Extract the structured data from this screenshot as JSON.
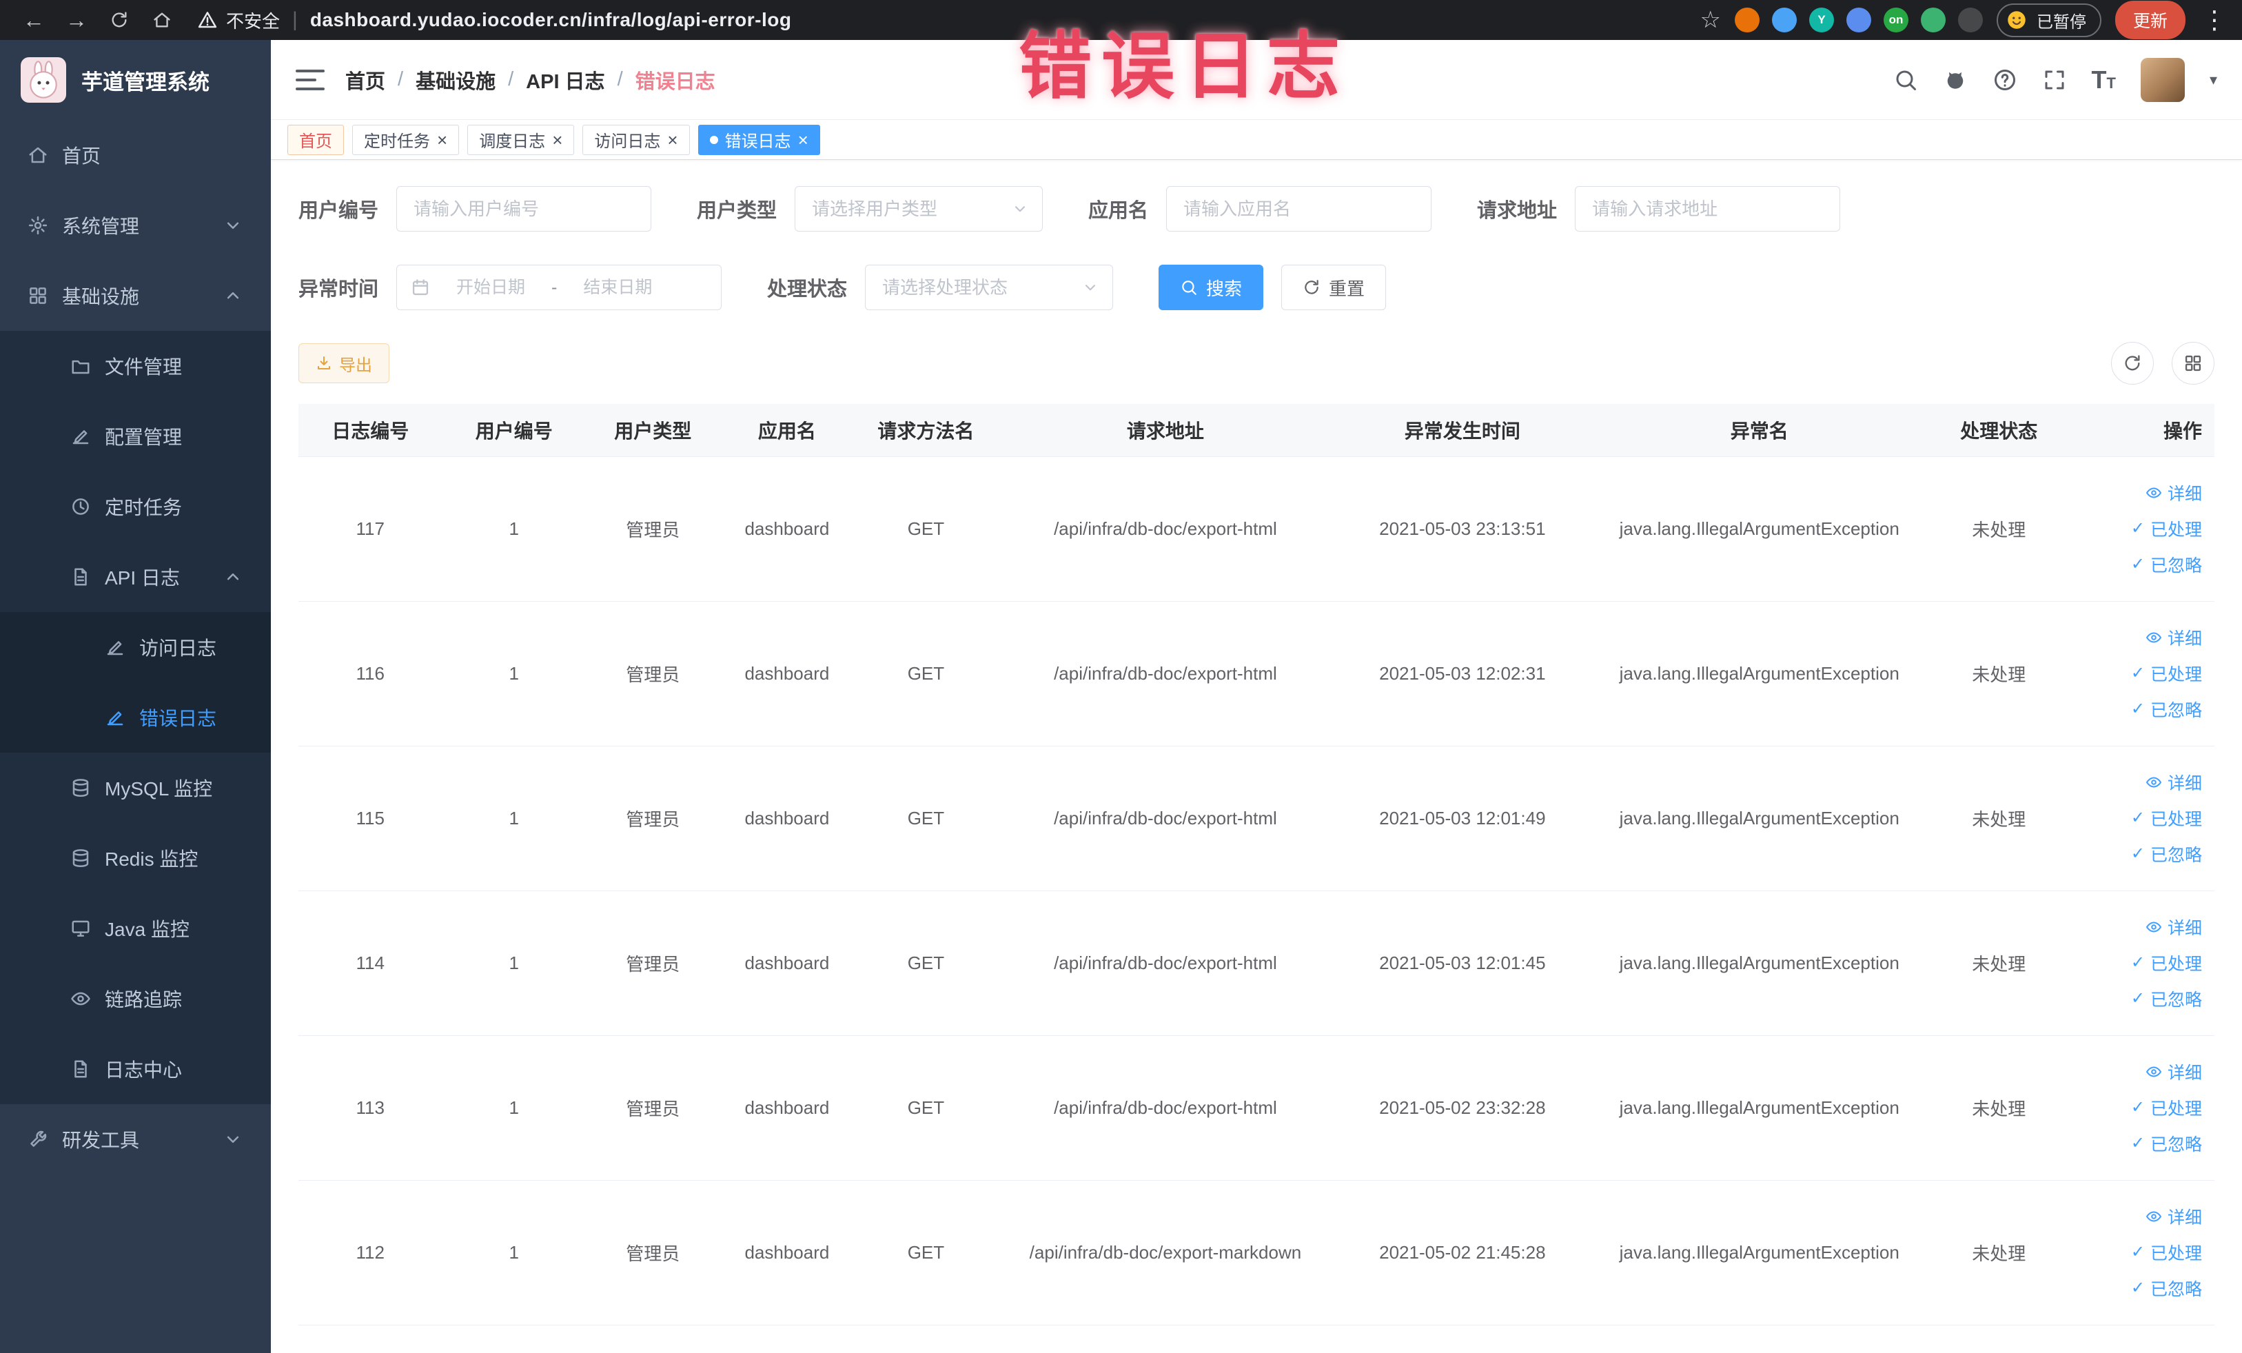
{
  "browser": {
    "security_label": "不安全",
    "url": "dashboard.yudao.iocoder.cn/infra/log/api-error-log",
    "paused_label": "已暂停",
    "update_label": "更新",
    "extensions": [
      {
        "color": "#e8710a"
      },
      {
        "color": "#4aa3f5"
      },
      {
        "color": "#12b7a5",
        "label": "Y"
      },
      {
        "color": "#5b8def"
      },
      {
        "color": "#27a844",
        "label": "on"
      },
      {
        "color": "#3cb371"
      },
      {
        "color": "#47484a"
      }
    ]
  },
  "overlay": {
    "title": "错误日志"
  },
  "sidebar": {
    "logo_title": "芋道管理系统",
    "menu": [
      {
        "label": "首页",
        "icon": "ic-home",
        "l1": true
      },
      {
        "label": "系统管理",
        "icon": "ic-gear",
        "l1": true,
        "chevron": true
      },
      {
        "label": "基础设施",
        "icon": "ic-grid",
        "l1": true,
        "chevron": true,
        "up": true
      },
      {
        "label": "文件管理",
        "icon": "ic-folder",
        "l2": true
      },
      {
        "label": "配置管理",
        "icon": "ic-edit",
        "l2": true
      },
      {
        "label": "定时任务",
        "icon": "ic-clock",
        "l2": true
      },
      {
        "label": "API 日志",
        "icon": "ic-doc",
        "l2": true,
        "chevron": true,
        "up": true
      },
      {
        "label": "访问日志",
        "icon": "ic-edit",
        "l3": true
      },
      {
        "label": "错误日志",
        "icon": "ic-edit",
        "l3": true,
        "active": true
      },
      {
        "label": "MySQL 监控",
        "icon": "ic-db",
        "l2": true
      },
      {
        "label": "Redis 监控",
        "icon": "ic-db",
        "l2": true
      },
      {
        "label": "Java 监控",
        "icon": "ic-monitor",
        "l2": true
      },
      {
        "label": "链路追踪",
        "icon": "ic-eye",
        "l2": true
      },
      {
        "label": "日志中心",
        "icon": "ic-doc",
        "l2": true
      },
      {
        "label": "研发工具",
        "icon": "ic-wrench",
        "l1": true,
        "chevron": true
      }
    ]
  },
  "header": {
    "breadcrumb": [
      {
        "label": "首页"
      },
      {
        "label": "基础设施"
      },
      {
        "label": "API 日志"
      },
      {
        "label": "错误日志",
        "current": true
      }
    ]
  },
  "tabs": [
    {
      "label": "首页",
      "affix": true
    },
    {
      "label": "定时任务",
      "closable": true
    },
    {
      "label": "调度日志",
      "closable": true
    },
    {
      "label": "访问日志",
      "closable": true
    },
    {
      "label": "错误日志",
      "closable": true,
      "active": true
    }
  ],
  "filters": {
    "user_id": {
      "label": "用户编号",
      "placeholder": "请输入用户编号"
    },
    "user_type": {
      "label": "用户类型",
      "placeholder": "请选择用户类型"
    },
    "app_name": {
      "label": "应用名",
      "placeholder": "请输入应用名"
    },
    "request_url": {
      "label": "请求地址",
      "placeholder": "请输入请求地址"
    },
    "exception_time": {
      "label": "异常时间",
      "start_placeholder": "开始日期",
      "separator": "-",
      "end_placeholder": "结束日期"
    },
    "process_status": {
      "label": "处理状态",
      "placeholder": "请选择处理状态"
    },
    "search_label": "搜索",
    "reset_label": "重置"
  },
  "toolbar": {
    "export_label": "导出"
  },
  "table": {
    "columns": [
      "日志编号",
      "用户编号",
      "用户类型",
      "应用名",
      "请求方法名",
      "请求地址",
      "异常发生时间",
      "异常名",
      "处理状态",
      "操作"
    ],
    "action_labels": [
      "详细",
      "已处理",
      "已忽略"
    ],
    "rows": [
      {
        "id": "117",
        "user_id": "1",
        "user_type": "管理员",
        "app": "dashboard",
        "method": "GET",
        "url": "/api/infra/db-doc/export-html",
        "time": "2021-05-03 23:13:51",
        "exception": "java.lang.IllegalArgumentException",
        "status": "未处理"
      },
      {
        "id": "116",
        "user_id": "1",
        "user_type": "管理员",
        "app": "dashboard",
        "method": "GET",
        "url": "/api/infra/db-doc/export-html",
        "time": "2021-05-03 12:02:31",
        "exception": "java.lang.IllegalArgumentException",
        "status": "未处理"
      },
      {
        "id": "115",
        "user_id": "1",
        "user_type": "管理员",
        "app": "dashboard",
        "method": "GET",
        "url": "/api/infra/db-doc/export-html",
        "time": "2021-05-03 12:01:49",
        "exception": "java.lang.IllegalArgumentException",
        "status": "未处理"
      },
      {
        "id": "114",
        "user_id": "1",
        "user_type": "管理员",
        "app": "dashboard",
        "method": "GET",
        "url": "/api/infra/db-doc/export-html",
        "time": "2021-05-03 12:01:45",
        "exception": "java.lang.IllegalArgumentException",
        "status": "未处理"
      },
      {
        "id": "113",
        "user_id": "1",
        "user_type": "管理员",
        "app": "dashboard",
        "method": "GET",
        "url": "/api/infra/db-doc/export-html",
        "time": "2021-05-02 23:32:28",
        "exception": "java.lang.IllegalArgumentException",
        "status": "未处理"
      },
      {
        "id": "112",
        "user_id": "1",
        "user_type": "管理员",
        "app": "dashboard",
        "method": "GET",
        "url": "/api/infra/db-doc/export-markdown",
        "time": "2021-05-02 21:45:28",
        "exception": "java.lang.IllegalArgumentException",
        "status": "未处理"
      }
    ]
  }
}
